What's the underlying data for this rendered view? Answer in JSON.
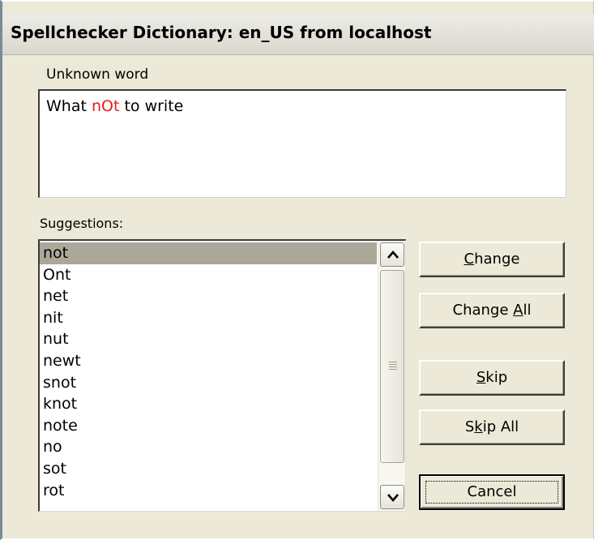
{
  "window": {
    "title": "Spellchecker Dictionary: en_US from localhost"
  },
  "unknown_word": {
    "label": "Unknown word",
    "sentence_before": "What ",
    "misspelled": "nOt",
    "sentence_after": " to write"
  },
  "suggestions": {
    "label": "Suggestions:",
    "selected": "not",
    "items": [
      "not",
      "Ont",
      "net",
      "nit",
      "nut",
      "newt",
      "snot",
      "knot",
      "note",
      "no",
      "sot",
      "rot"
    ]
  },
  "buttons": {
    "change": {
      "pre": "",
      "mnemonic": "C",
      "post": "hange"
    },
    "change_all": {
      "pre": "Change ",
      "mnemonic": "A",
      "post": "ll"
    },
    "skip": {
      "pre": "",
      "mnemonic": "S",
      "post": "kip"
    },
    "skip_all": {
      "pre": "S",
      "mnemonic": "k",
      "post": "ip All"
    },
    "cancel": {
      "label": "Cancel"
    }
  },
  "colors": {
    "dialog_bg": "#ece9d8",
    "misspelled_text": "#e31c1c",
    "selection_bg": "#aca899"
  },
  "icons": {
    "scroll_up": "chevron-up-icon",
    "scroll_down": "chevron-down-icon"
  }
}
